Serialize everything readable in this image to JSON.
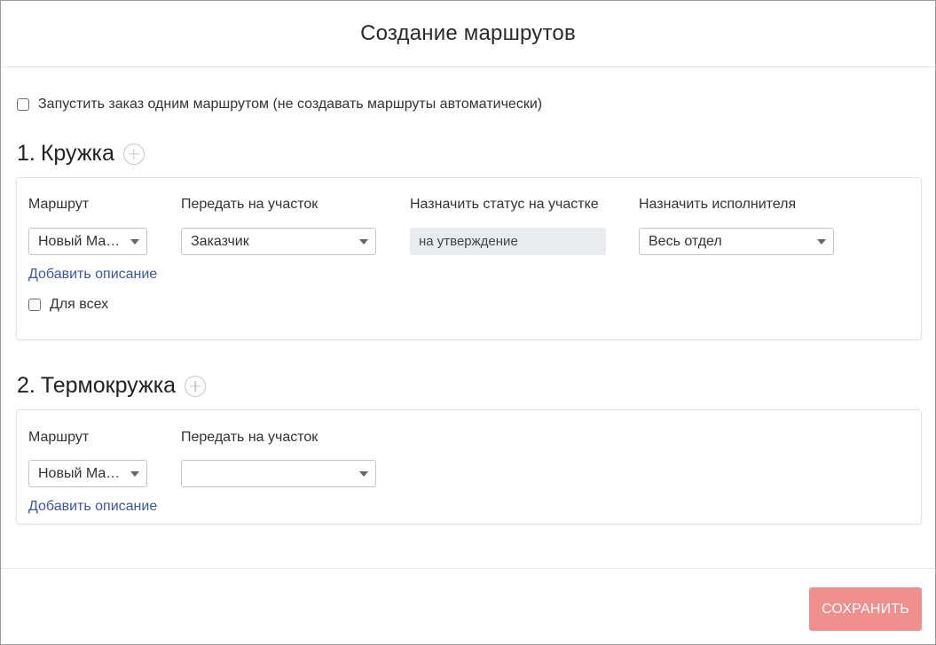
{
  "dialog": {
    "title": "Создание маршрутов",
    "single_route_label": "Запустить заказ одним маршрутом (не создавать маршруты автоматически)",
    "save_label": "СОХРАНИТЬ"
  },
  "labels": {
    "route": "Маршрут",
    "transfer": "Передать на участок",
    "status": "Назначить статус на участке",
    "executor": "Назначить исполнителя",
    "add_description": "Добавить описание",
    "for_all": "Для всех"
  },
  "sections": [
    {
      "number": "1.",
      "name": "Кружка",
      "route_value": "Новый Маршрут",
      "transfer_value": "Заказчик",
      "status_value": "на утверждение",
      "executor_value": "Весь отдел"
    },
    {
      "number": "2.",
      "name": "Термокружка",
      "route_value": "Новый Маршрут",
      "transfer_value": ""
    }
  ],
  "colors": {
    "accent_button": "#f0908c",
    "link": "#3e5799",
    "readonly_bg": "#e9ecef"
  }
}
